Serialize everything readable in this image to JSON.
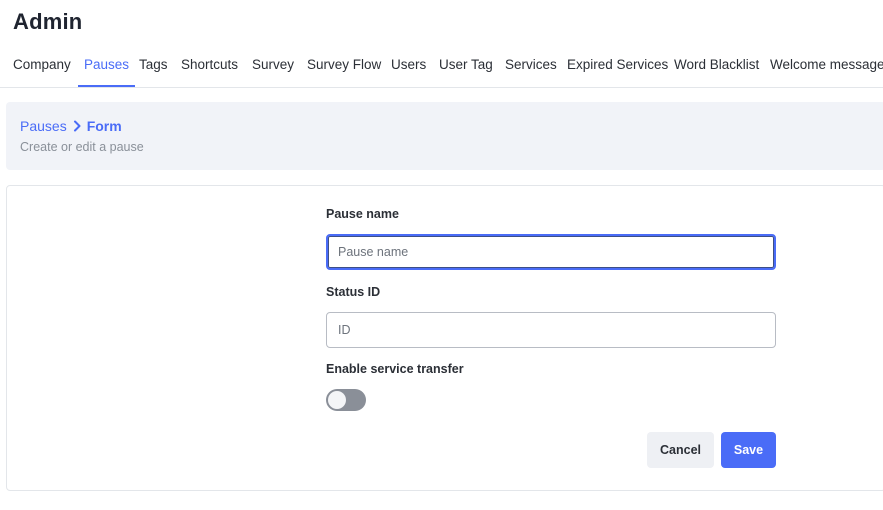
{
  "page": {
    "title": "Admin"
  },
  "tabs": [
    {
      "label": "Company"
    },
    {
      "label": "Pauses",
      "active": true
    },
    {
      "label": "Tags"
    },
    {
      "label": "Shortcuts"
    },
    {
      "label": "Survey"
    },
    {
      "label": "Survey Flow"
    },
    {
      "label": "Users"
    },
    {
      "label": "User Tag"
    },
    {
      "label": "Services"
    },
    {
      "label": "Expired Services"
    },
    {
      "label": "Word Blacklist"
    },
    {
      "label": "Welcome message"
    }
  ],
  "header": {
    "breadcrumb_parent": "Pauses",
    "breadcrumb_icon": "chevron-right-icon",
    "breadcrumb_current": "Form",
    "subtitle": "Create or edit a pause"
  },
  "form": {
    "pause_name": {
      "label": "Pause name",
      "value": "",
      "placeholder": "Pause name"
    },
    "status_id": {
      "label": "Status ID",
      "value": "",
      "placeholder": "ID"
    },
    "service_transfer": {
      "label": "Enable service transfer",
      "enabled": false
    },
    "cancel_label": "Cancel",
    "save_label": "Save"
  },
  "colors": {
    "accent": "#4a6cf7",
    "toggle_off": "#8a8f98",
    "header_bg": "#f1f3f8"
  }
}
